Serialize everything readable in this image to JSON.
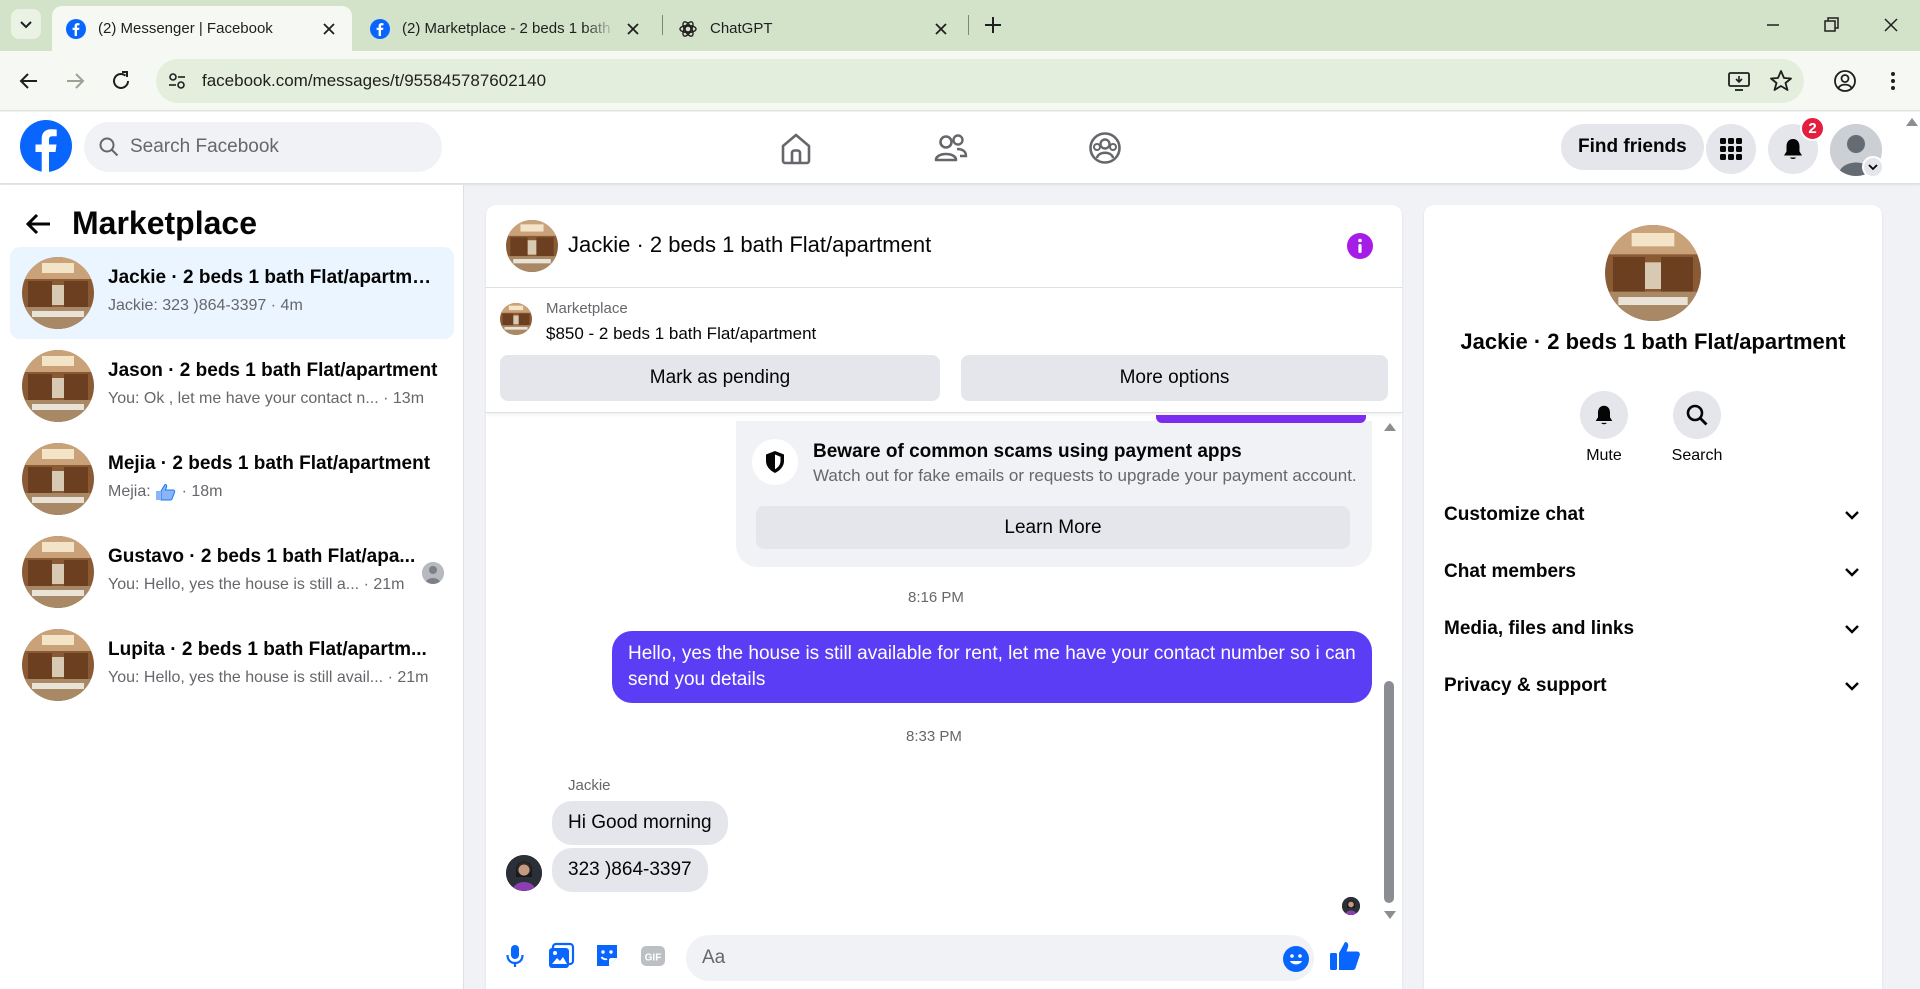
{
  "browser": {
    "tabs": [
      {
        "title": "(2) Messenger | Facebook",
        "active": true
      },
      {
        "title": "(2) Marketplace - 2 beds 1 bath",
        "active": false
      },
      {
        "title": "ChatGPT",
        "active": false
      }
    ],
    "url": "facebook.com/messages/t/955845787602140"
  },
  "header": {
    "search_placeholder": "Search Facebook",
    "find_friends": "Find friends",
    "notification_count": "2"
  },
  "left": {
    "title": "Marketplace",
    "conversations": [
      {
        "name": "Jackie · 2 beds 1 bath Flat/apartme...",
        "preview": "Jackie: 323 )864-3397",
        "time": "· 4m",
        "selected": true
      },
      {
        "name": "Jason · 2 beds 1 bath Flat/apartment",
        "preview": "You: Ok , let me have your contact n...",
        "time": "· 13m",
        "selected": false
      },
      {
        "name": "Mejia · 2 beds 1 bath Flat/apartment",
        "preview": "Mejia:",
        "time": "· 18m",
        "selected": false,
        "thumb": true
      },
      {
        "name": "Gustavo · 2 beds 1 bath Flat/apa...",
        "preview": "You: Hello, yes the house is still a...",
        "time": "· 21m",
        "selected": false,
        "seen": true
      },
      {
        "name": "Lupita · 2 beds 1 bath Flat/apartm...",
        "preview": "You: Hello, yes the house is still avail...",
        "time": "· 21m",
        "selected": false
      }
    ]
  },
  "chat": {
    "title": "Jackie · 2 beds 1 bath Flat/apartment",
    "marketplace_label": "Marketplace",
    "listing": "$850 - 2 beds 1 bath Flat/apartment",
    "mark_pending": "Mark as pending",
    "more_options": "More options",
    "scam_title": "Beware of common scams using payment apps",
    "scam_desc": "Watch out for fake emails or requests to upgrade your payment account.",
    "learn_more": "Learn More",
    "time1": "8:16 PM",
    "outgoing": "Hello, yes the house is still available for rent, let me have your contact number so i can send you details",
    "time2": "8:33 PM",
    "sender": "Jackie",
    "incoming1": "Hi Good morning",
    "incoming2": "323 )864-3397",
    "composer_placeholder": "Aa"
  },
  "right": {
    "name": "Jackie · 2 beds 1 bath Flat/apartment",
    "mute": "Mute",
    "search": "Search",
    "sections": [
      "Customize chat",
      "Chat members",
      "Media, files and links",
      "Privacy & support"
    ]
  },
  "colors": {
    "accent_purple": "#5b3df5",
    "facebook_blue": "#0866ff",
    "selected_bg": "#ebf5ff",
    "info_purple": "#a51de6"
  }
}
